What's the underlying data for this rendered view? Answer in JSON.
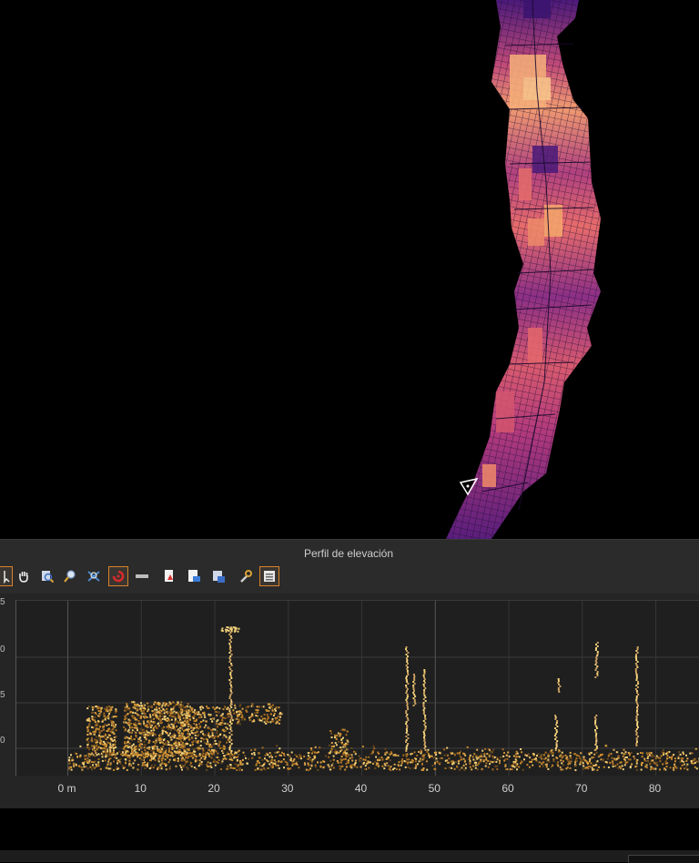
{
  "panel": {
    "title": "Perfil de elevación",
    "toolbar": [
      {
        "icon": "select-pointer-icon",
        "active": true
      },
      {
        "icon": "pan-hand-icon",
        "active": false
      },
      {
        "icon": "zoom-full-icon",
        "active": false
      },
      {
        "icon": "zoom-in-icon",
        "active": false
      },
      {
        "icon": "zoom-layer-icon",
        "active": false
      },
      {
        "icon": "capture-profile-icon",
        "active": true
      },
      {
        "icon": "clear-line-icon",
        "active": false
      },
      {
        "icon": "export-pdf-icon",
        "active": false
      },
      {
        "icon": "export-image-icon",
        "active": false
      },
      {
        "icon": "save-profile-icon",
        "active": false
      },
      {
        "icon": "settings-wrench-icon",
        "active": false
      },
      {
        "icon": "options-panel-icon",
        "active": true
      }
    ]
  },
  "chart_data": {
    "type": "scatter",
    "xlabel": "",
    "ylabel": "",
    "x_tick_labels": [
      "0 m",
      "10",
      "20",
      "30",
      "40",
      "50",
      "60",
      "70",
      "80"
    ],
    "x_ticks": [
      0,
      10,
      20,
      30,
      40,
      50,
      60,
      70,
      80
    ],
    "xlim": [
      -7,
      86
    ],
    "grid": true,
    "colors": {
      "ground": "#c98a2a",
      "highlight": "#f3d27a",
      "dark": "#6b4a1c"
    }
  },
  "map": {
    "colors": [
      "#2a1060",
      "#4b1a7a",
      "#7a2a88",
      "#b0417f",
      "#e0666d",
      "#f59a6a",
      "#fbc98c"
    ]
  }
}
